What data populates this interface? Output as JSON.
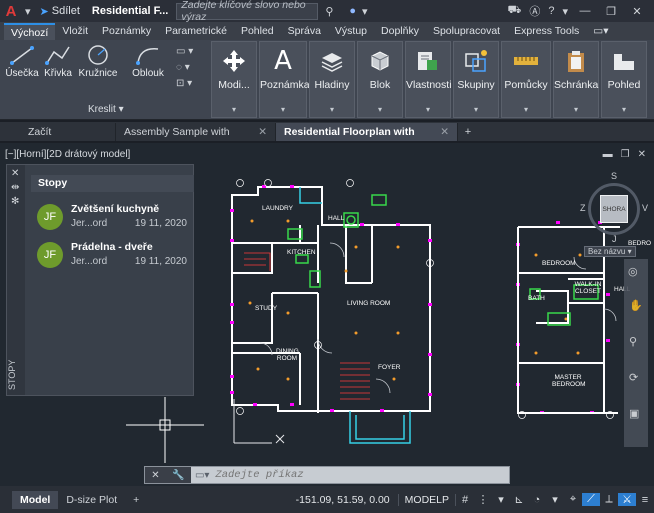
{
  "titlebar": {
    "share_label": "Sdílet",
    "file_title": "Residential F...",
    "search_placeholder": "Zadejte klíčové slovo nebo výraz"
  },
  "ribbon_tabs": [
    "Výchozí",
    "Vložit",
    "Poznámky",
    "Parametrické",
    "Pohled",
    "Správa",
    "Výstup",
    "Doplňky",
    "Spolupracovat",
    "Express Tools"
  ],
  "draw_panel": {
    "tools": [
      "Úsečka",
      "Křivka",
      "Kružnice",
      "Oblouk"
    ],
    "label": "Kreslit"
  },
  "ribbon_buttons": [
    "Modi...",
    "Poznámka",
    "Hladiny",
    "Blok",
    "Vlastnosti",
    "Skupiny",
    "Pomůcky",
    "Schránka",
    "Pohled"
  ],
  "doc_tabs": [
    {
      "label": "Začít"
    },
    {
      "label": "Assembly Sample with Traces*"
    },
    {
      "label": "Residential Floorplan with Traces*"
    }
  ],
  "viewport": {
    "label": "[−][Horní][2D drátový model]",
    "viewcube_top": "SHORA",
    "viewcube_n": "S",
    "viewcube_s": "J",
    "viewcube_w": "Z",
    "viewcube_e": "V",
    "viewcube_badge": "Bez názvu"
  },
  "traces": {
    "header": "Stopy",
    "side_label": "STOPY",
    "items": [
      {
        "initials": "JF",
        "title": "Zvětšení kuchyně",
        "author": "Jer...ord",
        "date": "19 11, 2020"
      },
      {
        "initials": "JF",
        "title": "Prádelna - dveře",
        "author": "Jer...ord",
        "date": "19 11, 2020"
      }
    ]
  },
  "plan_labels": {
    "laundry": "LAUNDRY",
    "kitchen": "KITCHEN",
    "living": "LIVING ROOM",
    "study": "STUDY",
    "dining": "DINING ROOM",
    "foyer": "FOYER",
    "hall": "HALL",
    "bedroom1": "BEDROOM",
    "bedroom2": "BEDRO",
    "walkin": "WALK-IN CLOSET",
    "bath": "BATH",
    "master": "MASTER BEDROOM",
    "hall2": "HALL"
  },
  "commandline": {
    "placeholder": "Zadejte příkaz"
  },
  "statusbar": {
    "tabs": [
      "Model",
      "D-size Plot"
    ],
    "coords": "-151.09, 51.59, 0.00",
    "space": "MODELP"
  },
  "colors": {
    "accent": "#2d8fe6",
    "avatar": "#6e9b2c",
    "wall": "#ffffff",
    "trace": "#ff00ff",
    "cyan": "#35d0e6",
    "green": "#38d84a",
    "marker": "#f39c2b"
  }
}
